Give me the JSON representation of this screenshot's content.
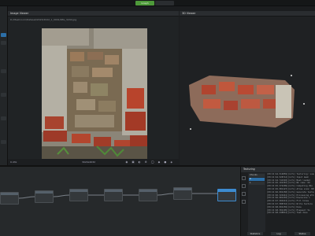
{
  "header": {
    "tab_active": "Graph",
    "tab_inactive": ""
  },
  "image_viewer": {
    "title": "Image Viewer",
    "path": "D:/Meshroom/Dataset/2023/2022_1_0001/IMG_3240.jpg",
    "zoom": "0.43x",
    "resolution": "3024x4032",
    "footer_icons": "◉ ▣ ◐ ⚙ ◯ ◆ ● ◈"
  },
  "viewer3d": {
    "title": "3D Viewer"
  },
  "log": {
    "title": "Texturing",
    "chunk_label": "Chunks",
    "chunks": [
      "0",
      "1"
    ],
    "lines": [
      "[09:21:44.514859][info] Texturing: Loading",
      "[09:21:44.528712][info] Input mesh",
      "[09:21:44.741503][info] Mesh loaded",
      "[09:21:45.102387][info] Nb cams: 69",
      "[09:21:45.372209][info] Computing UVs",
      "[09:21:45.581127][info] Atlas size: 8192",
      "[09:21:46.002158][info] Generate textures",
      "[09:21:46.324441][info] Processing atlas",
      "[09:21:46.981203][info] Downscale 1",
      "[09:21:47.204413][info] Fill holes",
      "[09:21:47.588742][info] Write texture",
      "[09:21:48.002159][info] Done",
      "[09:21:48.302105][info] Elapsed: 5s",
      "[09:21:48.448812][info] Task done"
    ],
    "btn_left": "Statistics",
    "btn_mid": "Log",
    "btn_right": "Status"
  }
}
